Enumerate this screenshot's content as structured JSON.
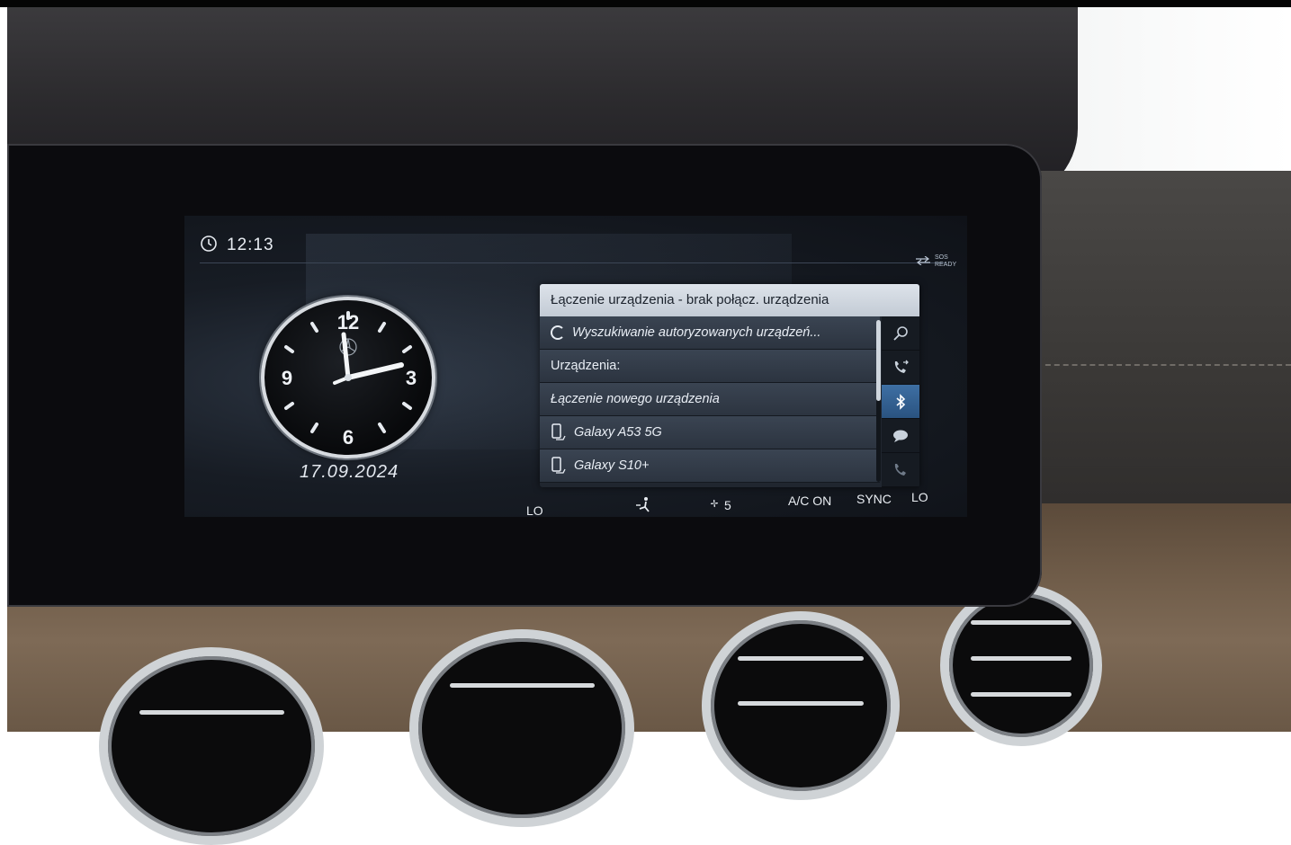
{
  "status": {
    "time": "12:13",
    "sos_line1": "SOS",
    "sos_line2": "READY"
  },
  "clock": {
    "numerals": [
      "12",
      "3",
      "6",
      "9"
    ],
    "date": "17.09.2024"
  },
  "dialog": {
    "title": "Łączenie urządzenia - brak połącz. urządzenia",
    "rows": [
      "Wyszukiwanie autoryzowanych urządzeń...",
      "Urządzenia:",
      "Łączenie nowego urządzenia",
      "Galaxy A53 5G",
      "Galaxy S10+"
    ],
    "side_buttons": [
      "search-icon",
      "phone-transfer-icon",
      "bluetooth-icon",
      "message-icon",
      "phone-icon"
    ]
  },
  "climate": {
    "left_temp": "LO",
    "fan_level": "5",
    "ac": "A/C ON",
    "sync": "SYNC",
    "right_temp": "LO"
  },
  "colors": {
    "screen_bg": "#171c24",
    "dialog_header": "#c3cbd5",
    "list_row": "#2c3440",
    "active_button": "#2a5380"
  }
}
